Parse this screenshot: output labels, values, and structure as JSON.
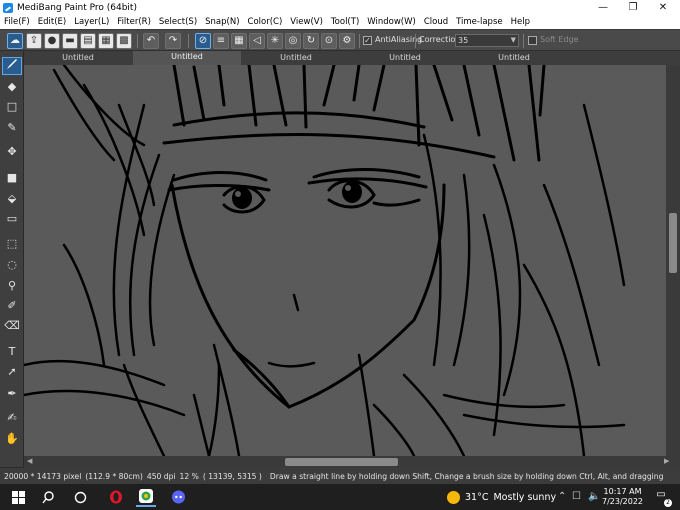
{
  "window": {
    "title": "MediBang Paint Pro (64bit)",
    "minimize": "—",
    "restore": "❐",
    "close": "✕"
  },
  "menu": [
    "File(F)",
    "Edit(E)",
    "Layer(L)",
    "Filter(R)",
    "Select(S)",
    "Snap(N)",
    "Color(C)",
    "View(V)",
    "Tool(T)",
    "Window(W)",
    "Cloud",
    "Time-lapse",
    "Help"
  ],
  "toolbar": {
    "antialiasing_label": "AntiAliasing",
    "antialiasing_checked": true,
    "correction_label": "Correction",
    "correction_value": "35",
    "soft_edge_label": "Soft Edge",
    "soft_edge_checked": false
  },
  "tabs": [
    "Untitled",
    "Untitled",
    "Untitled",
    "Untitled",
    "Untitled"
  ],
  "active_tab": 1,
  "tools": [
    "brush-icon",
    "eraser-icon",
    "rectangle-icon",
    "dot-brush-icon",
    "move-icon",
    "fill-rect-icon",
    "bucket-icon",
    "gradient-icon",
    "select-rect-icon",
    "lasso-icon",
    "magic-wand-icon",
    "select-pen-icon",
    "select-eraser-icon",
    "text-icon",
    "operation-icon",
    "eyedropper-icon",
    "pen-icon",
    "hand-icon"
  ],
  "status": {
    "size": "20000 * 14173 pixel",
    "physical": "(112.9 * 80cm)",
    "dpi": "450 dpi",
    "zoom": "12 %",
    "coords": "( 13139, 5315 )",
    "hint": "Draw a straight line by holding down Shift, Change a brush size by holding down Ctrl, Alt, and dragging"
  },
  "taskbar": {
    "temperature": "31°C",
    "weather": "Mostly sunny",
    "time": "10:17 AM",
    "date": "7/23/2022",
    "notifications": "2"
  },
  "colors": {
    "canvas": "#5a5a5a",
    "accent": "#2a5d8f",
    "ink": "#000000",
    "toolbar": "#4a4a4a"
  }
}
